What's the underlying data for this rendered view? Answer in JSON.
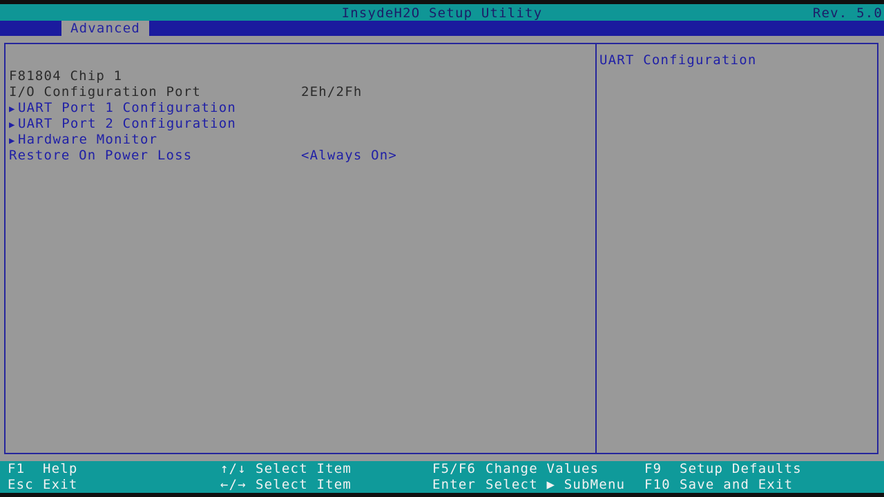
{
  "header": {
    "title": "InsydeH2O Setup Utility",
    "revision": "Rev. 5.0"
  },
  "tabs": [
    {
      "label": "Advanced",
      "active": true
    }
  ],
  "menu": {
    "section_title": "F81804 Chip 1",
    "items": [
      {
        "label": "I/O Configuration Port",
        "value": "2Eh/2Fh",
        "submenu": false,
        "interactive": false
      },
      {
        "label": "UART Port 1 Configuration",
        "value": "",
        "submenu": true,
        "interactive": true
      },
      {
        "label": "UART Port 2 Configuration",
        "value": "",
        "submenu": true,
        "interactive": true
      },
      {
        "label": "Hardware Monitor",
        "value": "",
        "submenu": true,
        "interactive": true
      },
      {
        "label": "Restore On Power Loss",
        "value": "<Always On>",
        "submenu": false,
        "interactive": true
      }
    ],
    "submenu_arrow": "▶"
  },
  "help_panel": {
    "text": "UART Configuration"
  },
  "footer": {
    "keys": [
      {
        "key": "F1",
        "action": "Help"
      },
      {
        "key": "Esc",
        "action": "Exit"
      },
      {
        "key": "↑/↓",
        "action": "Select Item"
      },
      {
        "key": "←/→",
        "action": "Select Item"
      },
      {
        "key": "F5/F6",
        "action": "Change Values"
      },
      {
        "key": "Enter",
        "action": "Select ▶ SubMenu"
      },
      {
        "key": "F9",
        "action": "Setup Defaults"
      },
      {
        "key": "F10",
        "action": "Save and Exit"
      }
    ]
  },
  "colors": {
    "title_bar": "#0f9696",
    "tab_bar": "#1b1b9e",
    "panel_background": "#999999",
    "link_text": "#1f1fa6",
    "static_text": "#2b2b2b",
    "footer": "#0f9a9a"
  }
}
